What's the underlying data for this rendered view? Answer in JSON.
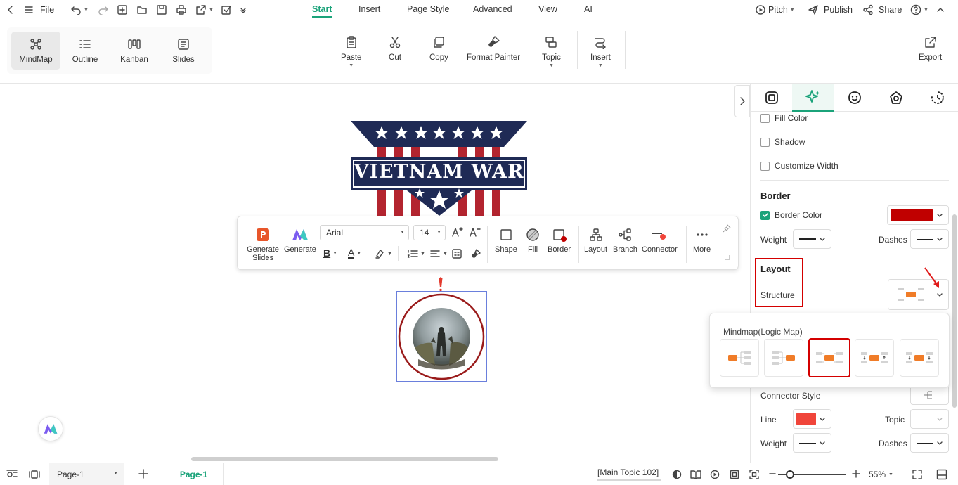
{
  "topbar": {
    "file_label": "File",
    "menu_tabs": [
      "Start",
      "Insert",
      "Page Style",
      "Advanced",
      "View",
      "AI"
    ],
    "active_tab": "Start",
    "pitch_label": "Pitch",
    "publish_label": "Publish",
    "share_label": "Share"
  },
  "ribbon": {
    "views": [
      "MindMap",
      "Outline",
      "Kanban",
      "Slides"
    ],
    "paste": "Paste",
    "cut": "Cut",
    "copy": "Copy",
    "format_painter": "Format Painter",
    "topic": "Topic",
    "insert": "Insert",
    "export": "Export"
  },
  "banner": {
    "text": "VIETNAM WAR",
    "colors": {
      "navy": "#1f2a55",
      "red": "#b3242f"
    }
  },
  "float_toolbar": {
    "generate_slides": "Generate Slides",
    "generate": "Generate",
    "font": "Arial",
    "font_size": "14",
    "shape": "Shape",
    "fill": "Fill",
    "border": "Border",
    "layout": "Layout",
    "branch": "Branch",
    "connector": "Connector",
    "more": "More"
  },
  "panel": {
    "fill_color": "Fill Color",
    "shadow": "Shadow",
    "customize_width": "Customize Width",
    "border_heading": "Border",
    "border_color": "Border Color",
    "border_color_value": "#c00000",
    "weight": "Weight",
    "dashes": "Dashes",
    "layout_heading": "Layout",
    "structure": "Structure",
    "connector_style": "Connector Style",
    "line": "Line",
    "line_color_value": "#f0453a",
    "topic": "Topic",
    "weight2": "Weight",
    "dashes2": "Dashes"
  },
  "layout_popup": {
    "title": "Mindmap(Logic Map)",
    "selected_index": 2
  },
  "statusbar": {
    "page_select": "Page-1",
    "page_tab": "Page-1",
    "selection": "[Main Topic 102]",
    "zoom": "55%",
    "accent": "#1ba37a"
  }
}
